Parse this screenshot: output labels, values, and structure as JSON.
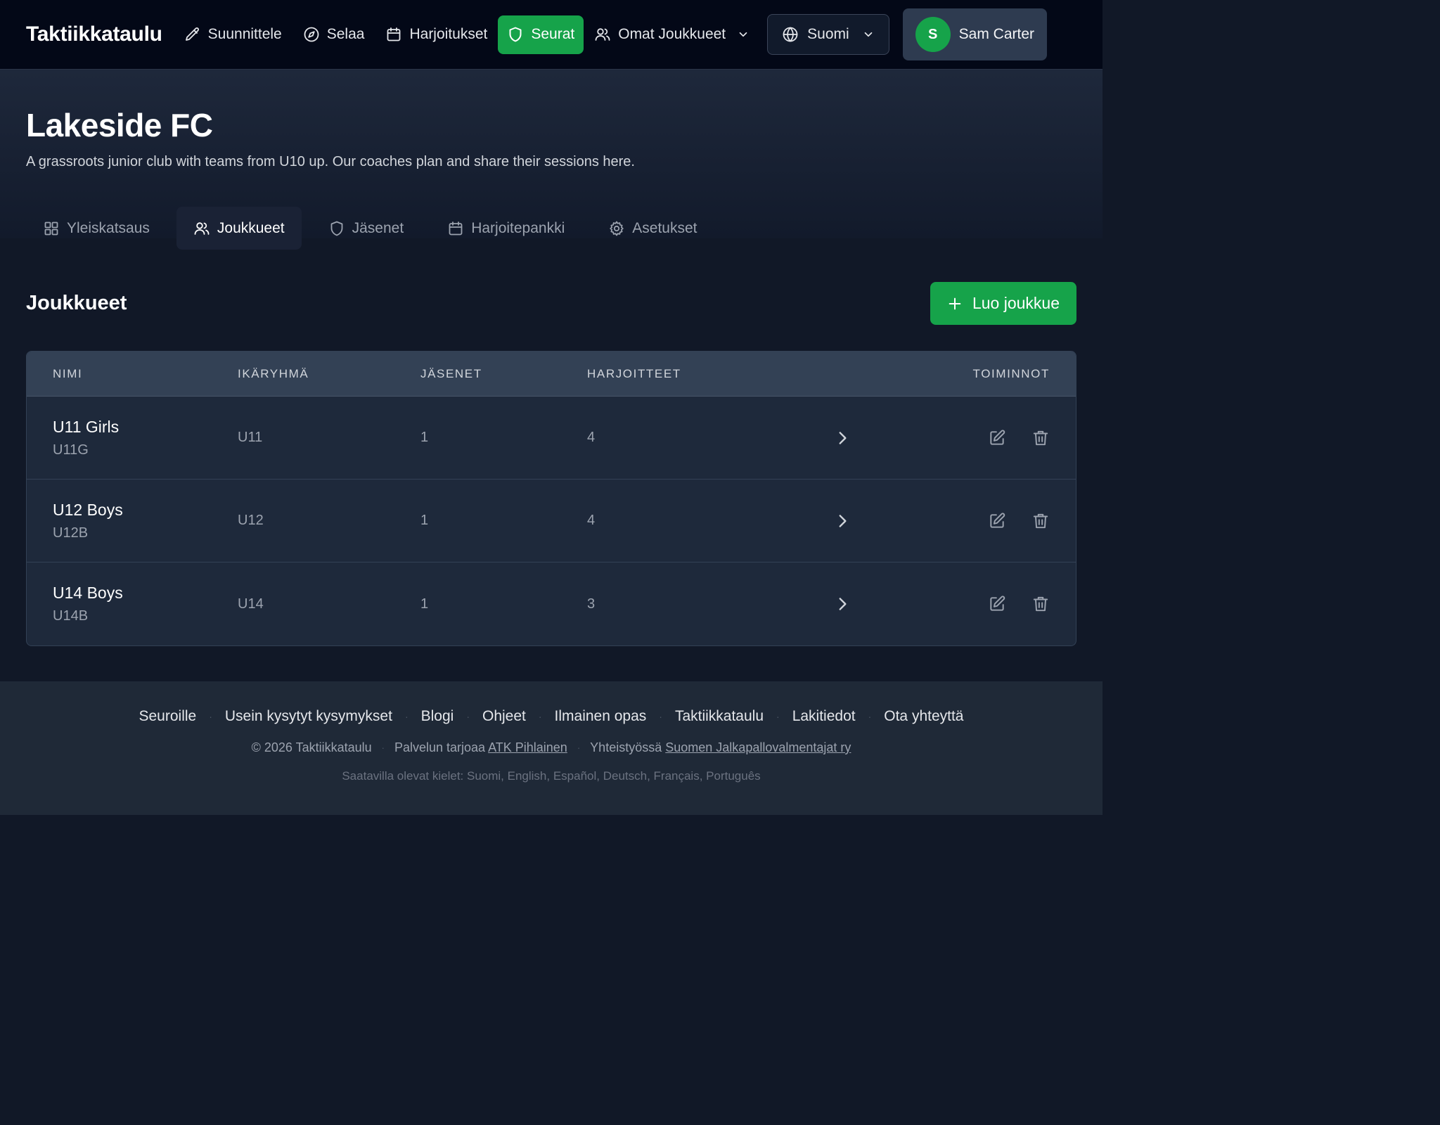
{
  "nav": {
    "brand": "Taktiikkataulu",
    "items": [
      {
        "label": "Suunnittele",
        "icon": "pencil-icon"
      },
      {
        "label": "Selaa",
        "icon": "compass-icon"
      },
      {
        "label": "Harjoitukset",
        "icon": "calendar-icon"
      },
      {
        "label": "Seurat",
        "icon": "shield-icon",
        "active": true
      },
      {
        "label": "Omat Joukkueet",
        "icon": "users-icon",
        "dropdown": true
      }
    ],
    "language": "Suomi",
    "user": {
      "initial": "S",
      "name": "Sam Carter"
    }
  },
  "club": {
    "name": "Lakeside FC",
    "description": "A grassroots junior club with teams from U10 up. Our coaches plan and share their sessions here."
  },
  "tabs": [
    {
      "label": "Yleiskatsaus",
      "icon": "grid-icon"
    },
    {
      "label": "Joukkueet",
      "icon": "users-icon",
      "active": true
    },
    {
      "label": "Jäsenet",
      "icon": "shield-icon"
    },
    {
      "label": "Harjoitepankki",
      "icon": "calendar-icon"
    },
    {
      "label": "Asetukset",
      "icon": "gear-icon"
    }
  ],
  "section": {
    "title": "Joukkueet",
    "create_label": "Luo joukkue"
  },
  "table": {
    "headers": {
      "name": "NIMI",
      "age": "IKÄRYHMÄ",
      "members": "JÄSENET",
      "exercises": "HARJOITTEET",
      "actions": "TOIMINNOT"
    },
    "rows": [
      {
        "name": "U11 Girls",
        "code": "U11G",
        "age": "U11",
        "members": "1",
        "exercises": "4"
      },
      {
        "name": "U12 Boys",
        "code": "U12B",
        "age": "U12",
        "members": "1",
        "exercises": "4"
      },
      {
        "name": "U14 Boys",
        "code": "U14B",
        "age": "U14",
        "members": "1",
        "exercises": "3"
      }
    ]
  },
  "footer": {
    "links": [
      "Seuroille",
      "Usein kysytyt kysymykset",
      "Blogi",
      "Ohjeet",
      "Ilmainen opas",
      "Taktiikkataulu",
      "Lakitiedot",
      "Ota yhteyttä"
    ],
    "copyright": "© 2026 Taktiikkataulu",
    "provider_prefix": "Palvelun tarjoaa",
    "provider_link": "ATK Pihlainen",
    "partner_prefix": "Yhteistyössä",
    "partner_link": "Suomen Jalkapallovalmentajat ry",
    "languages": "Saatavilla olevat kielet: Suomi, English, Español, Deutsch, Français, Português"
  },
  "colors": {
    "accent": "#16a34a",
    "nav_bg": "#030817",
    "page_bg": "#111827",
    "table_bg": "#1e293b",
    "footer_bg": "#1f2937"
  }
}
